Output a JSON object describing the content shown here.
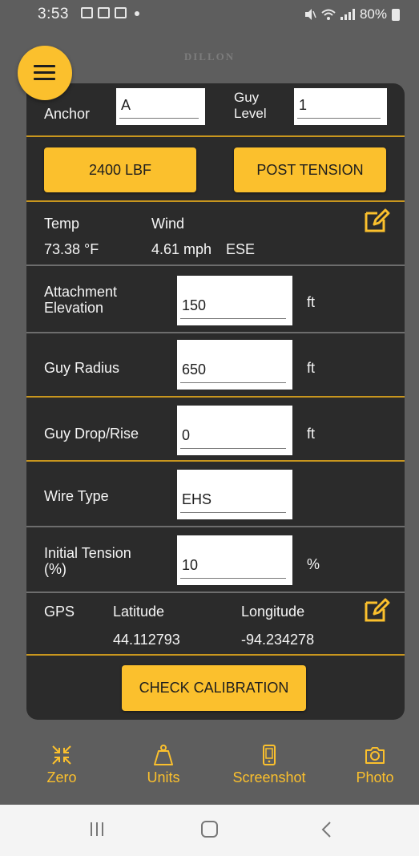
{
  "status_bar": {
    "time": "3:53",
    "right_text": "80%",
    "notification_icons": [
      "message-icon",
      "image-icon",
      "message-icon",
      "dot-icon"
    ],
    "system_icons": [
      "mute-icon",
      "wifi-icon",
      "signal-icon",
      "battery-icon"
    ]
  },
  "app": {
    "logo_text": "DILLON"
  },
  "menu_button": {
    "icon": "hamburger-icon",
    "color": "#fbc02d"
  },
  "anchor_row": {
    "anchor_label": "Anchor",
    "anchor_value": "A",
    "guy_level_label_line1": "Guy",
    "guy_level_label_line2": "Level",
    "guy_level_value": "1"
  },
  "action_buttons": {
    "lbf_label": "2400 LBF",
    "post_tension_label": "POST TENSION"
  },
  "weather": {
    "temp_label": "Temp",
    "wind_label": "Wind",
    "temp_value": "73.38 °F",
    "wind_value": "4.61 mph",
    "wind_direction": "ESE",
    "edit_icon": "edit-icon"
  },
  "fields": {
    "attachment_elevation": {
      "label_line1": "Attachment",
      "label_line2": "Elevation",
      "value": "150",
      "unit": "ft"
    },
    "guy_radius": {
      "label": "Guy Radius",
      "value": "650",
      "unit": "ft"
    },
    "guy_drop_rise": {
      "label": "Guy Drop/Rise",
      "value": "0",
      "unit": "ft"
    },
    "wire_type": {
      "label": "Wire Type",
      "value": "EHS"
    },
    "initial_tension": {
      "label_line1": "Initial Tension",
      "label_line2": "(%)",
      "value": "10",
      "unit": "%"
    }
  },
  "gps": {
    "label": "GPS",
    "latitude_label": "Latitude",
    "longitude_label": "Longitude",
    "latitude_value": "44.112793",
    "longitude_value": "-94.234278",
    "edit_icon": "edit-icon"
  },
  "check_calibration_label": "CHECK CALIBRATION",
  "bottom_nav": [
    {
      "label": "Zero",
      "icon": "zero-icon"
    },
    {
      "label": "Units",
      "icon": "weight-icon"
    },
    {
      "label": "Screenshot",
      "icon": "phone-screenshot-icon"
    },
    {
      "label": "Photo",
      "icon": "camera-icon"
    }
  ],
  "colors": {
    "accent": "#fbc02d",
    "card_background": "#2b2b2b",
    "page_background": "#5e5e5e",
    "divider_gold": "#c8961e"
  }
}
